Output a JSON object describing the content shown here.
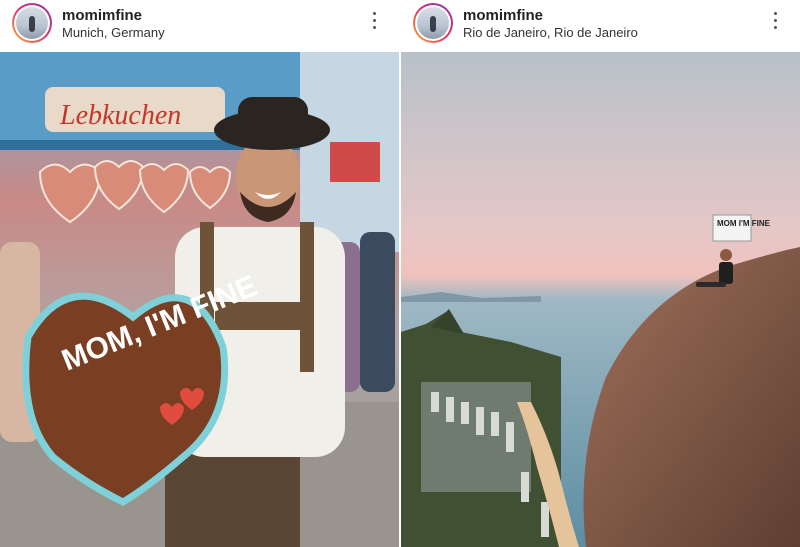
{
  "posts": [
    {
      "username": "momimfine",
      "location": "Munich, Germany",
      "photo_sign": "MOM, I'M FINE",
      "more_icon": "three-dots-vertical-icon"
    },
    {
      "username": "momimfine",
      "location": "Rio de Janeiro, Rio de Janeiro",
      "photo_sign": "MOM I'M FINE",
      "more_icon": "three-dots-vertical-icon"
    }
  ],
  "colors": {
    "story_ring_start": "#f9b233",
    "story_ring_mid": "#e1306c",
    "story_ring_end": "#833ab4"
  }
}
